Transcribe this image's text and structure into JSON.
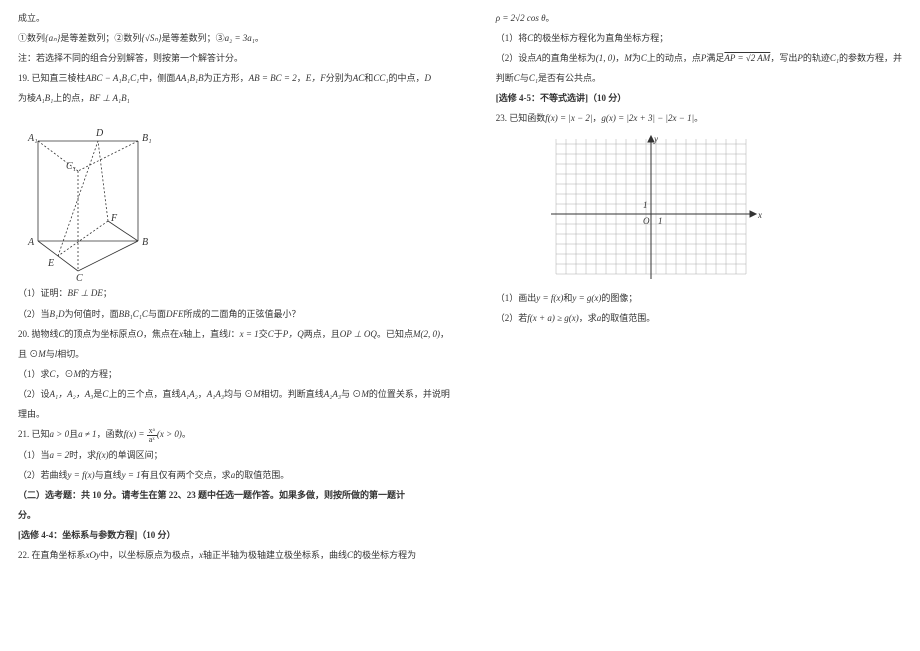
{
  "left": {
    "l1": "成立。",
    "l2_a": "①数列",
    "l2_b": "是等差数列；②数列",
    "l2_c": "是等差数列；③",
    "l2_seq1": "{aₙ}",
    "l2_seq2": "{√Sₙ}",
    "l2_eq": "a₂ = 3a₁",
    "l2_d": "。",
    "l3": "注：若选择不同的组合分别解答，则按第一个解答计分。",
    "q19_a": "19.  已知直三棱柱",
    "q19_prism": "ABC − A₁B₁C₁",
    "q19_b": "中，侧面",
    "q19_face": "AA₁B₁B",
    "q19_c": "为正方形，",
    "q19_eq1": "AB = BC = 2",
    "q19_d": "，",
    "q19_ef": "E，F",
    "q19_e": "分别为",
    "q19_ac": "AC",
    "q19_f": "和",
    "q19_cc": "CC₁",
    "q19_g": "的中点，",
    "q19_dv": "D",
    "q19_l2a": "为棱",
    "q19_ab": "A₁B₁",
    "q19_l2b": "上的点，",
    "q19_perp": "BF ⊥ A₁B₁",
    "labels": {
      "A1": "A₁",
      "B1": "B₁",
      "C1": "C₁",
      "A": "A",
      "B": "B",
      "C": "C",
      "D": "D",
      "E": "E",
      "F": "F"
    },
    "q19_1a": "（1）证明：",
    "q19_1b": "BF ⊥ DE",
    "q19_1c": "；",
    "q19_2a": "（2）当",
    "q19_2b": "B₁D",
    "q19_2c": "为何值时，面",
    "q19_2d": "BB₁C₁C",
    "q19_2e": "与面",
    "q19_2f": "DFE",
    "q19_2g": "所成的二面角的正弦值最小？",
    "q20_a": "20.  抛物线",
    "q20_cv": "C",
    "q20_b": "的顶点为坐标原点",
    "q20_ov": "O",
    "q20_c": "，焦点在",
    "q20_xv": "x",
    "q20_d": "轴上，直线",
    "q20_lv": "l",
    "q20_e": "：",
    "q20_eq": "x = 1",
    "q20_f": "交",
    "q20_g": "于",
    "q20_pq": "P，Q",
    "q20_h": "两点，且",
    "q20_perp": "OP ⊥ OQ",
    "q20_i": "。已知点",
    "q20_mv": "M(2, 0)",
    "q20_j": "，",
    "q20_l2a": "且 ⊙",
    "q20_l2m": "M",
    "q20_l2b": "与",
    "q20_l2l": "l",
    "q20_l2c": "相切。",
    "q20_1a": "（1）求",
    "q20_1c": "C",
    "q20_1b": "，⊙",
    "q20_1m": "M",
    "q20_1d": "的方程；",
    "q20_2a": "（2）设",
    "q20_2pts": "A₁，A₂，A₃",
    "q20_2b": "是",
    "q20_2c": "C",
    "q20_2d": "上的三个点，直线",
    "q20_2l1": "A₁A₂",
    "q20_2e": "，",
    "q20_2l2": "A₁A₃",
    "q20_2f": "均与 ⊙",
    "q20_2m": "M",
    "q20_2g": "相切。判断直线",
    "q20_2l3": "A₂A₃",
    "q20_2h": "与 ⊙",
    "q20_2i": "M",
    "q20_2j": "的位置关系，并说明",
    "q20_l3": "理由。",
    "q21_a": "21.  已知",
    "q21_cond": "a > 0",
    "q21_b": "且",
    "q21_cond2": "a ≠ 1",
    "q21_c": "，函数",
    "q21_fn": "f(x) = ",
    "q21_num": "xᵃ",
    "q21_den": "aˣ",
    "q21_d": "(x > 0)",
    "q21_e": "。",
    "q21_1a": "（1）当",
    "q21_1eq": "a = 2",
    "q21_1b": "时，求",
    "q21_1f": "f(x)",
    "q21_1c": "的单调区间；",
    "q21_2a": "（2）若曲线",
    "q21_2eq": "y = f(x)",
    "q21_2b": "与直线",
    "q21_2eq2": "y = 1",
    "q21_2c": "有且仅有两个交点，求",
    "q21_2av": "a",
    "q21_2d": "的取值范围。",
    "sec2_a": "（二）选考题：共 10 分。请考生在第 22、23 题中任选一题作答。如果多做，则按所做的第一题计",
    "sec2_b": "分。",
    "mod44": "[选修 4-4：坐标系与参数方程]（10 分）",
    "q22_a": "22.  在直角坐标系",
    "q22_xoy": "xOy",
    "q22_b": "中，以坐标原点为极点，",
    "q22_xv": "x",
    "q22_c": "轴正半轴为极轴建立极坐标系，曲线",
    "q22_cv": "C",
    "q22_d": "的极坐标方程为"
  },
  "right": {
    "eq": "ρ = 2√2 cos θ",
    "eq_end": "。",
    "q22_1a": "（1）将",
    "q22_1c": "C",
    "q22_1b": "的极坐标方程化为直角坐标方程；",
    "q22_2a": "（2）设点",
    "q22_2av": "A",
    "q22_2b": "的直角坐标为",
    "q22_2pt": "(1, 0)",
    "q22_2c": "，",
    "q22_2mv": "M",
    "q22_2d": "为",
    "q22_2cv": "C",
    "q22_2e": "上的动点，点",
    "q22_2pv": "P",
    "q22_2f": "满足",
    "q22_2vec": "AP = √2 AM",
    "q22_2g": "，写出",
    "q22_2ph": "P",
    "q22_2h": "的轨迹",
    "q22_2c1": "C₁",
    "q22_2i": "的参数方程，并",
    "q22_l2a": "判断",
    "q22_l2c": "C",
    "q22_l2b": "与",
    "q22_l2c1": "C₁",
    "q22_l2d": "是否有公共点。",
    "mod45": "[选修 4-5：不等式选讲]（10 分）",
    "q23_a": "23.  已知函数",
    "q23_f": "f(x) = |x − 2|",
    "q23_b": "，",
    "q23_g": "g(x) = |2x + 3| − |2x − 1|",
    "q23_c": "。",
    "axis_y": "y",
    "axis_x": "x",
    "axis_o": "O",
    "axis_1": "1",
    "q23_1a": "（1）画出",
    "q23_1f": "y = f(x)",
    "q23_1b": "和",
    "q23_1g": "y = g(x)",
    "q23_1c": "的图像；",
    "q23_2a": "（2）若",
    "q23_2eq": "f(x + a) ≥ g(x)",
    "q23_2b": "，求",
    "q23_2av": "a",
    "q23_2c": "的取值范围。"
  }
}
